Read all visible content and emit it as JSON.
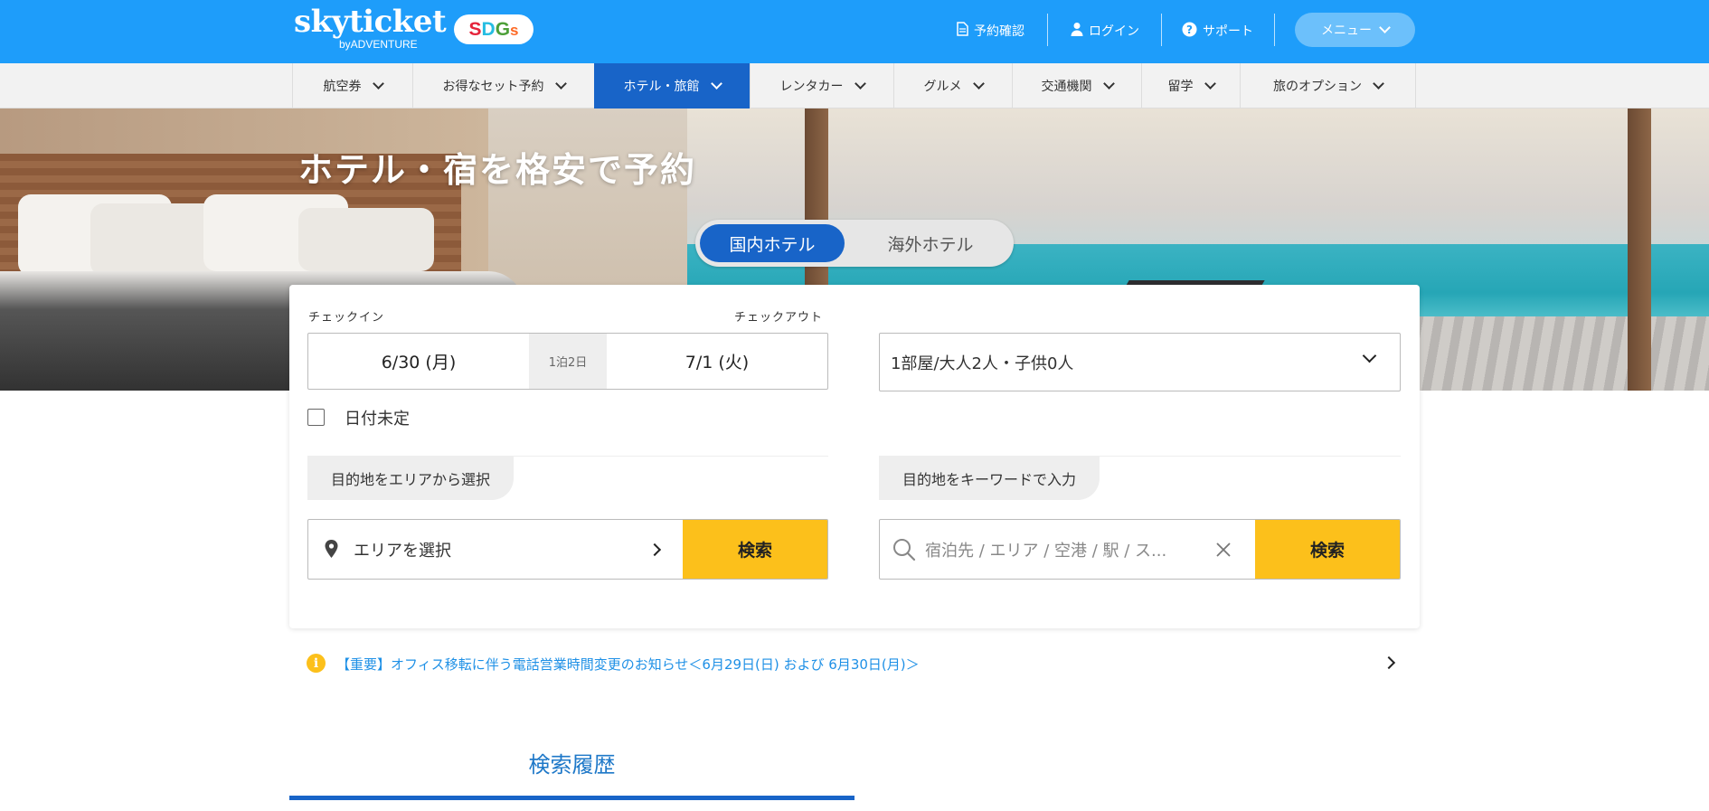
{
  "brand": {
    "logo_main": "skyticket",
    "logo_sub": "byADVENTURE",
    "sdgs": [
      "S",
      "D",
      "G",
      "s"
    ],
    "sdgs_colors": [
      "#e5243b",
      "#26bde2",
      "#4c9f38",
      "#fd6925"
    ]
  },
  "header": {
    "links": [
      {
        "label": "予約確認",
        "icon": "document-icon"
      },
      {
        "label": "ログイン",
        "icon": "user-icon"
      },
      {
        "label": "サポート",
        "icon": "help-icon"
      }
    ],
    "menu_label": "メニュー"
  },
  "nav": {
    "items": [
      {
        "label": "航空券"
      },
      {
        "label": "お得なセット予約"
      },
      {
        "label": "ホテル・旅館",
        "active": true
      },
      {
        "label": "レンタカー"
      },
      {
        "label": "グルメ"
      },
      {
        "label": "交通機関"
      },
      {
        "label": "留学"
      },
      {
        "label": "旅のオプション"
      }
    ]
  },
  "hero": {
    "title": "ホテル・宿を格安で予約",
    "tabs": [
      "国内ホテル",
      "海外ホテル"
    ]
  },
  "search": {
    "checkin_label": "チェックイン",
    "checkout_label": "チェックアウト",
    "checkin_date": "6/30 (月)",
    "nights": "1泊2日",
    "checkout_date": "7/1 (火)",
    "guests": "1部屋/大人2人・子供0人",
    "undecided_label": "日付未定",
    "area_tab": "目的地をエリアから選択",
    "keyword_tab": "目的地をキーワードで入力",
    "area_placeholder": "エリアを選択",
    "keyword_placeholder": "宿泊先 / エリア / 空港 / 駅 / ス...",
    "search_button": "検索"
  },
  "notice": {
    "text": "【重要】オフィス移転に伴う電話営業時間変更のお知らせ＜6月29日(日) および 6月30日(月)＞"
  },
  "history": {
    "tab_label": "検索履歴"
  },
  "colors": {
    "header_blue": "#1e9dfa",
    "active_blue": "#1864c8",
    "search_yellow": "#fcc01b",
    "link_blue": "#1e90e6"
  }
}
